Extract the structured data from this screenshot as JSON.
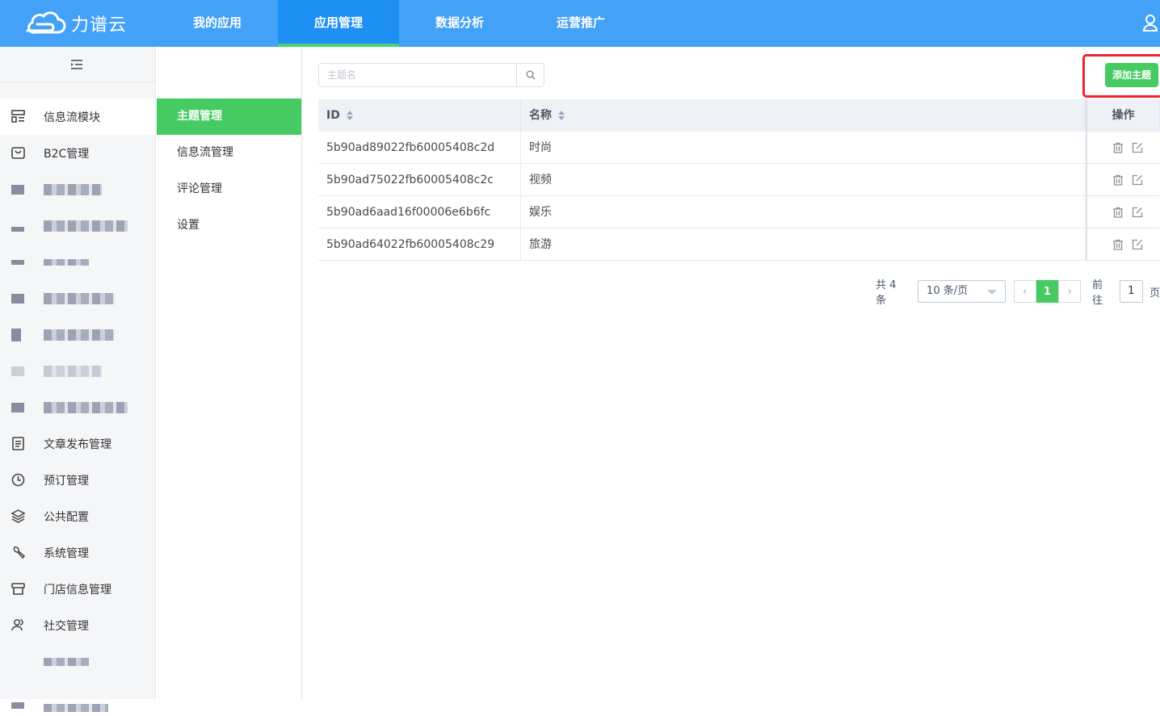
{
  "app": {
    "logo_text": "力谱云"
  },
  "nav": {
    "items": [
      "我的应用",
      "应用管理",
      "数据分析",
      "运营推广"
    ],
    "active": "应用管理"
  },
  "sidebar": {
    "items": [
      {
        "label": "信息流模块",
        "icon": "layout-icon"
      },
      {
        "label": "B2C管理",
        "icon": "bag-icon"
      },
      {
        "label": "",
        "icon": "blurred-icon"
      },
      {
        "label": "",
        "icon": "blurred-icon"
      },
      {
        "label": "",
        "icon": "blurred-icon"
      },
      {
        "label": "",
        "icon": "blurred-icon"
      },
      {
        "label": "",
        "icon": "blurred-icon"
      },
      {
        "label": "",
        "icon": "blurred-icon"
      },
      {
        "label": "",
        "icon": "blurred-icon"
      },
      {
        "label": "文章发布管理",
        "icon": "document-icon"
      },
      {
        "label": "预订管理",
        "icon": "clock-icon"
      },
      {
        "label": "公共配置",
        "icon": "layers-icon"
      },
      {
        "label": "系统管理",
        "icon": "wrench-icon"
      },
      {
        "label": "门店信息管理",
        "icon": "store-icon"
      },
      {
        "label": "社交管理",
        "icon": "users-icon"
      }
    ]
  },
  "subnav": {
    "items": [
      "主题管理",
      "信息流管理",
      "评论管理",
      "设置"
    ],
    "active": "主题管理"
  },
  "search": {
    "placeholder": "主题名",
    "value": ""
  },
  "toolbar": {
    "add_label": "添加主题"
  },
  "table": {
    "headers": {
      "id": "ID",
      "name": "名称",
      "ops": "操作"
    },
    "rows": [
      {
        "id": "5b90ad89022fb60005408c2d",
        "name": "时尚"
      },
      {
        "id": "5b90ad75022fb60005408c2c",
        "name": "视频"
      },
      {
        "id": "5b90ad6aad16f00006e6b6fc",
        "name": "娱乐"
      },
      {
        "id": "5b90ad64022fb60005408c29",
        "name": "旅游"
      }
    ]
  },
  "pagination": {
    "total_text": "共 4 条",
    "page_size": "10 条/页",
    "current_page": "1",
    "goto_label": "前往",
    "goto_value": "1",
    "page_suffix": "页"
  },
  "colors": {
    "primary": "#44a1f8",
    "accent": "#45cb62",
    "highlight": "#f5202e"
  }
}
